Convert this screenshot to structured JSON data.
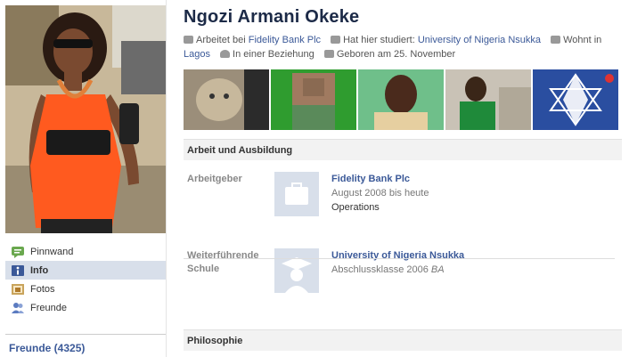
{
  "profile": {
    "name": "Ngozi Armani Okeke",
    "info": {
      "work_prefix": "Arbeitet bei",
      "work_link": "Fidelity Bank Plc",
      "study_prefix": "Hat hier studiert:",
      "study_link": "University of Nigeria Nsukka",
      "lives_prefix": "Wohnt in",
      "lives_link": "Lagos",
      "relationship": "In einer Beziehung",
      "birthday": "Geboren am 25. November"
    }
  },
  "nav": {
    "items": [
      {
        "label": "Pinnwand",
        "icon": "wall-icon"
      },
      {
        "label": "Info",
        "icon": "info-icon"
      },
      {
        "label": "Fotos",
        "icon": "photos-icon"
      },
      {
        "label": "Freunde",
        "icon": "friends-icon"
      }
    ],
    "friends_count_label": "Freunde (4325)"
  },
  "sections": {
    "work_edu": {
      "title": "Arbeit und Ausbildung",
      "employer_label": "Arbeitgeber",
      "employer_name": "Fidelity Bank Plc",
      "employer_period": "August 2008 bis heute",
      "employer_position": "Operations",
      "school_label_line1": "Weiterführende",
      "school_label_line2": "Schule",
      "school_name": "University of Nigeria Nsukka",
      "school_class": "Abschlussklasse 2006",
      "school_degree": "BA"
    },
    "philosophy": {
      "title": "Philosophie"
    }
  },
  "colors": {
    "link": "#3b5998",
    "nav_active": "#d8dfea",
    "name": "#1c2a47"
  }
}
